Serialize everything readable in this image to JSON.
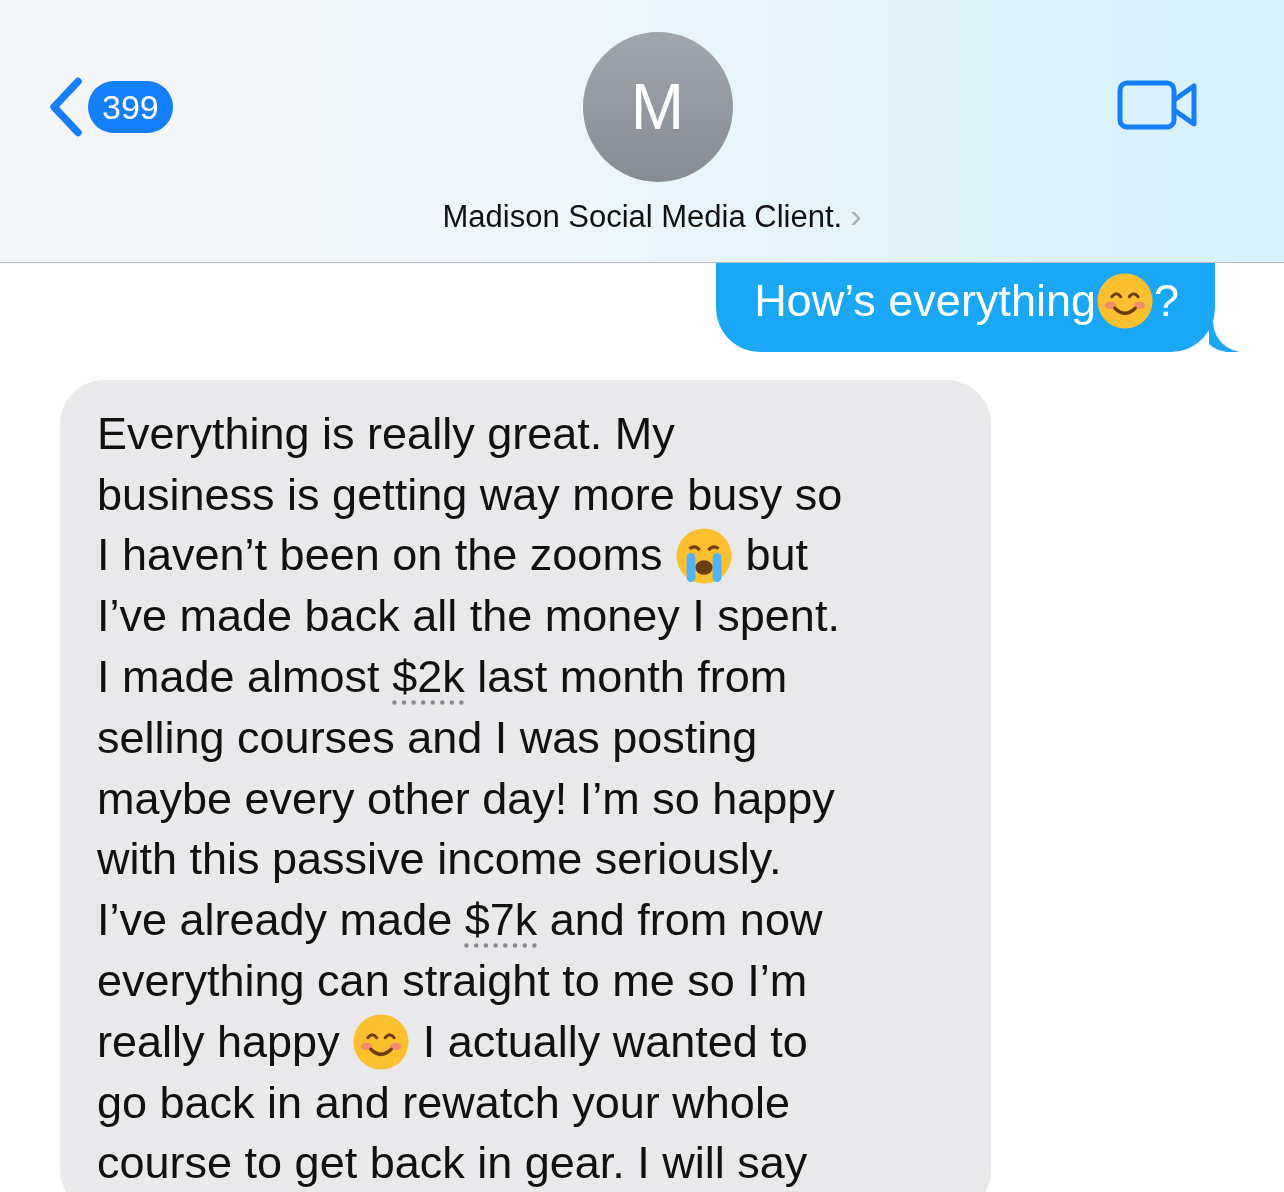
{
  "header": {
    "back_badge": "399",
    "avatar_initial": "M",
    "contact_name": "Madison Social Media Client.",
    "chevron": "›"
  },
  "messages": [
    {
      "kind": "sent",
      "lines": [
        [
          {
            "kind": "text",
            "text": "How’s everything"
          },
          {
            "kind": "smile-emoji"
          },
          {
            "kind": "text",
            "text": "?"
          }
        ]
      ]
    },
    {
      "kind": "received",
      "lines": [
        [
          {
            "kind": "text",
            "text": "Everything is really great. My"
          }
        ],
        [
          {
            "kind": "text",
            "text": "business is getting way more busy so"
          }
        ],
        [
          {
            "kind": "text",
            "text": "I haven’t been on the zooms "
          },
          {
            "kind": "cry-emoji"
          },
          {
            "kind": "text",
            "text": " but"
          }
        ],
        [
          {
            "kind": "text",
            "text": "I’ve made back all the money I spent."
          }
        ],
        [
          {
            "kind": "text",
            "text": "I made almost "
          },
          {
            "kind": "link",
            "text": "$2k"
          },
          {
            "kind": "text",
            "text": " last month from"
          }
        ],
        [
          {
            "kind": "text",
            "text": "selling courses and I was posting"
          }
        ],
        [
          {
            "kind": "text",
            "text": "maybe every other day! I’m so happy"
          }
        ],
        [
          {
            "kind": "text",
            "text": "with this passive income seriously."
          }
        ],
        [
          {
            "kind": "text",
            "text": "I’ve already made "
          },
          {
            "kind": "link",
            "text": "$7k"
          },
          {
            "kind": "text",
            "text": " and from now"
          }
        ],
        [
          {
            "kind": "text",
            "text": "everything can straight to me so I’m"
          }
        ],
        [
          {
            "kind": "text",
            "text": "really happy "
          },
          {
            "kind": "smile-emoji"
          },
          {
            "kind": "text",
            "text": " I actually wanted to"
          }
        ],
        [
          {
            "kind": "text",
            "text": "go back in and rewatch your whole"
          }
        ],
        [
          {
            "kind": "text",
            "text": "course to get back in gear. I will say"
          }
        ]
      ]
    }
  ]
}
